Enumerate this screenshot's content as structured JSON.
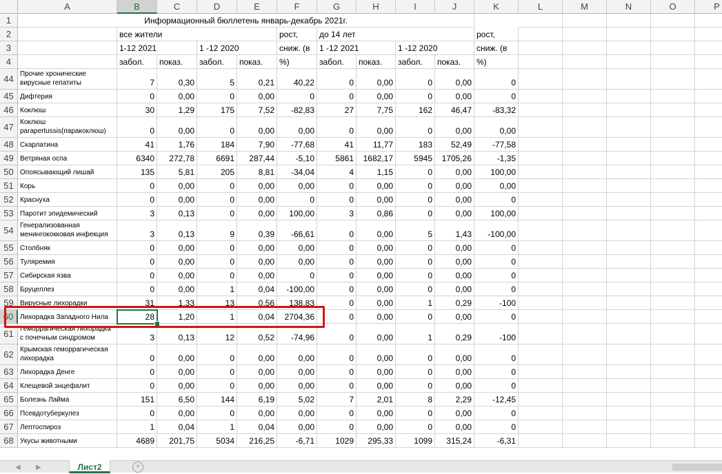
{
  "columns": [
    "A",
    "B",
    "C",
    "D",
    "E",
    "F",
    "G",
    "H",
    "I",
    "J",
    "K",
    "L",
    "M",
    "N",
    "O",
    "P"
  ],
  "selected_column": "B",
  "selected_row": "60",
  "header": {
    "title": "Информационный бюллетень январь-декабрь  2021г.",
    "all_residents": "все жители",
    "period_2021": "1-12  2021",
    "period_2020": "1 -12  2020",
    "growth_line1": "рост,",
    "growth_line2": "сниж. (в",
    "growth_line3": "%)",
    "under14": "до 14 лет",
    "period_2021_child": "1 -12 2021",
    "period_2020_child": "1 -12 2020",
    "cases": "забол.",
    "rate": "показ."
  },
  "header_row_numbers": [
    "1",
    "2",
    "3",
    "4"
  ],
  "rows": [
    {
      "n": "44",
      "name": "Прочие хронические вирусные гепатиты",
      "v": [
        "7",
        "0,30",
        "5",
        "0,21",
        "40,22",
        "0",
        "0,00",
        "0",
        "0,00",
        "0"
      ]
    },
    {
      "n": "45",
      "name": "Дифтерия",
      "v": [
        "0",
        "0,00",
        "0",
        "0,00",
        "0",
        "0",
        "0,00",
        "0",
        "0,00",
        "0"
      ]
    },
    {
      "n": "46",
      "name": "Коклюш",
      "v": [
        "30",
        "1,29",
        "175",
        "7,52",
        "-82,83",
        "27",
        "7,75",
        "162",
        "46,47",
        "-83,32"
      ]
    },
    {
      "n": "47",
      "name": "Коклюш parapertussis(паракоклюш)",
      "v": [
        "0",
        "0,00",
        "0",
        "0,00",
        "0,00",
        "0",
        "0,00",
        "0",
        "0,00",
        "0,00"
      ]
    },
    {
      "n": "48",
      "name": "Скарлатина",
      "v": [
        "41",
        "1,76",
        "184",
        "7,90",
        "-77,68",
        "41",
        "11,77",
        "183",
        "52,49",
        "-77,58"
      ]
    },
    {
      "n": "49",
      "name": "Ветряная оспа",
      "v": [
        "6340",
        "272,78",
        "6691",
        "287,44",
        "-5,10",
        "5861",
        "1682,17",
        "5945",
        "1705,26",
        "-1,35"
      ]
    },
    {
      "n": "50",
      "name": "Опоясывающий лишай",
      "v": [
        "135",
        "5,81",
        "205",
        "8,81",
        "-34,04",
        "4",
        "1,15",
        "0",
        "0,00",
        "100,00"
      ]
    },
    {
      "n": "51",
      "name": "Корь",
      "v": [
        "0",
        "0,00",
        "0",
        "0,00",
        "0,00",
        "0",
        "0,00",
        "0",
        "0,00",
        "0,00"
      ]
    },
    {
      "n": "52",
      "name": "Краснуха",
      "v": [
        "0",
        "0,00",
        "0",
        "0,00",
        "0",
        "0",
        "0,00",
        "0",
        "0,00",
        "0"
      ]
    },
    {
      "n": "53",
      "name": "Паротит эпидемический",
      "v": [
        "3",
        "0,13",
        "0",
        "0,00",
        "100,00",
        "3",
        "0,86",
        "0",
        "0,00",
        "100,00"
      ]
    },
    {
      "n": "54",
      "name": "Генерализованная менингококковая инфекция",
      "v": [
        "3",
        "0,13",
        "9",
        "0,39",
        "-66,61",
        "0",
        "0,00",
        "5",
        "1,43",
        "-100,00"
      ]
    },
    {
      "n": "55",
      "name": "Столбняк",
      "v": [
        "0",
        "0,00",
        "0",
        "0,00",
        "0,00",
        "0",
        "0,00",
        "0",
        "0,00",
        "0"
      ]
    },
    {
      "n": "56",
      "name": "Туляремия",
      "v": [
        "0",
        "0,00",
        "0",
        "0,00",
        "0,00",
        "0",
        "0,00",
        "0",
        "0,00",
        "0"
      ]
    },
    {
      "n": "57",
      "name": "Сибирская язва",
      "v": [
        "0",
        "0,00",
        "0",
        "0,00",
        "0",
        "0",
        "0,00",
        "0",
        "0,00",
        "0"
      ]
    },
    {
      "n": "58",
      "name": "Бруцеллез",
      "v": [
        "0",
        "0,00",
        "1",
        "0,04",
        "-100,00",
        "0",
        "0,00",
        "0",
        "0,00",
        "0"
      ]
    },
    {
      "n": "59",
      "name": "Вирусные лихорадки",
      "v": [
        "31",
        "1,33",
        "13",
        "0,56",
        "138,83",
        "0",
        "0,00",
        "1",
        "0,29",
        "-100"
      ]
    },
    {
      "n": "60",
      "name": "Лихорадка Западного Нила",
      "v": [
        "28",
        "1,20",
        "1",
        "0,04",
        "2704,36",
        "0",
        "0,00",
        "0",
        "0,00",
        "0"
      ]
    },
    {
      "n": "61",
      "name": "Геморрагическая лихорадка с почечным синдромом",
      "v": [
        "3",
        "0,13",
        "12",
        "0,52",
        "-74,96",
        "0",
        "0,00",
        "1",
        "0,29",
        "-100"
      ]
    },
    {
      "n": "62",
      "name": "Крымская геморрагическая лихорадка",
      "v": [
        "0",
        "0,00",
        "0",
        "0,00",
        "0,00",
        "0",
        "0,00",
        "0",
        "0,00",
        "0"
      ]
    },
    {
      "n": "63",
      "name": "Лихорадка Денге",
      "v": [
        "0",
        "0,00",
        "0",
        "0,00",
        "0,00",
        "0",
        "0,00",
        "0",
        "0,00",
        "0"
      ]
    },
    {
      "n": "64",
      "name": "Клещевой энцефалит",
      "v": [
        "0",
        "0,00",
        "0",
        "0,00",
        "0,00",
        "0",
        "0,00",
        "0",
        "0,00",
        "0"
      ]
    },
    {
      "n": "65",
      "name": "Болезнь Лайма",
      "v": [
        "151",
        "6,50",
        "144",
        "6,19",
        "5,02",
        "7",
        "2,01",
        "8",
        "2,29",
        "-12,45"
      ]
    },
    {
      "n": "66",
      "name": "Псевдотуберкулез",
      "v": [
        "0",
        "0,00",
        "0",
        "0,00",
        "0,00",
        "0",
        "0,00",
        "0",
        "0,00",
        "0"
      ]
    },
    {
      "n": "67",
      "name": "Лептоспироз",
      "v": [
        "1",
        "0,04",
        "1",
        "0,04",
        "0,00",
        "0",
        "0,00",
        "0",
        "0,00",
        "0"
      ]
    },
    {
      "n": "68",
      "name": "Укусы животными",
      "v": [
        "4689",
        "201,75",
        "5034",
        "216,25",
        "-6,71",
        "1029",
        "295,33",
        "1099",
        "315,24",
        "-6,31"
      ]
    }
  ],
  "sheet_tab": "Лист2",
  "add_sheet_label": "+",
  "icons": {
    "prev": "triangle-left-icon",
    "next": "triangle-right-icon"
  },
  "colors": {
    "excel_green": "#217346",
    "highlight_red": "#d01515"
  }
}
